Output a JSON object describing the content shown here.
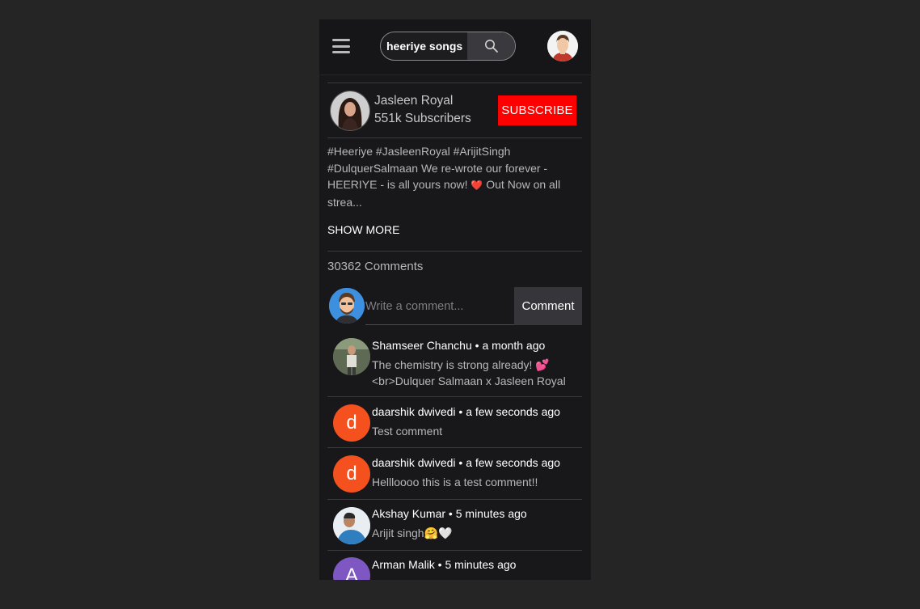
{
  "search": {
    "query": "heeriye songs"
  },
  "channel": {
    "name": "Jasleen Royal",
    "subscribers": "551k Subscribers",
    "subscribe_label": "SUBSCRIBE"
  },
  "description": {
    "line1": "#Heeriye #JasleenRoyal #ArijitSingh",
    "line2": "#DulquerSalmaan We re-wrote our forever -",
    "line3a": "HEERIYE - is all yours now!",
    "heart": "❤️",
    "line3b": "Out Now on all",
    "line4": "strea...",
    "show_more_label": "SHOW MORE"
  },
  "comments": {
    "count_label": "30362 Comments",
    "input_placeholder": "Write a comment...",
    "submit_label": "Comment",
    "items": [
      {
        "author": "Shamseer Chanchu",
        "time": "a month ago",
        "text1": "The chemistry is strong already! 💕",
        "text2": "<br>Dulquer Salmaan x Jasleen Royal"
      },
      {
        "author": "daarshik dwivedi",
        "time": "a few seconds ago",
        "text1": "Test comment",
        "initial": "d"
      },
      {
        "author": "daarshik dwivedi",
        "time": "a few seconds ago",
        "text1": "Hellloooo this is a test comment!!",
        "initial": "d"
      },
      {
        "author": "Akshay Kumar",
        "time": "5 minutes ago",
        "text1": "Arijit singh🤗🤍"
      },
      {
        "author": "Arman Malik",
        "time": "5 minutes ago",
        "initial": "A"
      }
    ]
  },
  "colors": {
    "subscribe": "#ff0000",
    "avatar_orange": "#f4511e",
    "avatar_purple": "#7e57c2"
  }
}
